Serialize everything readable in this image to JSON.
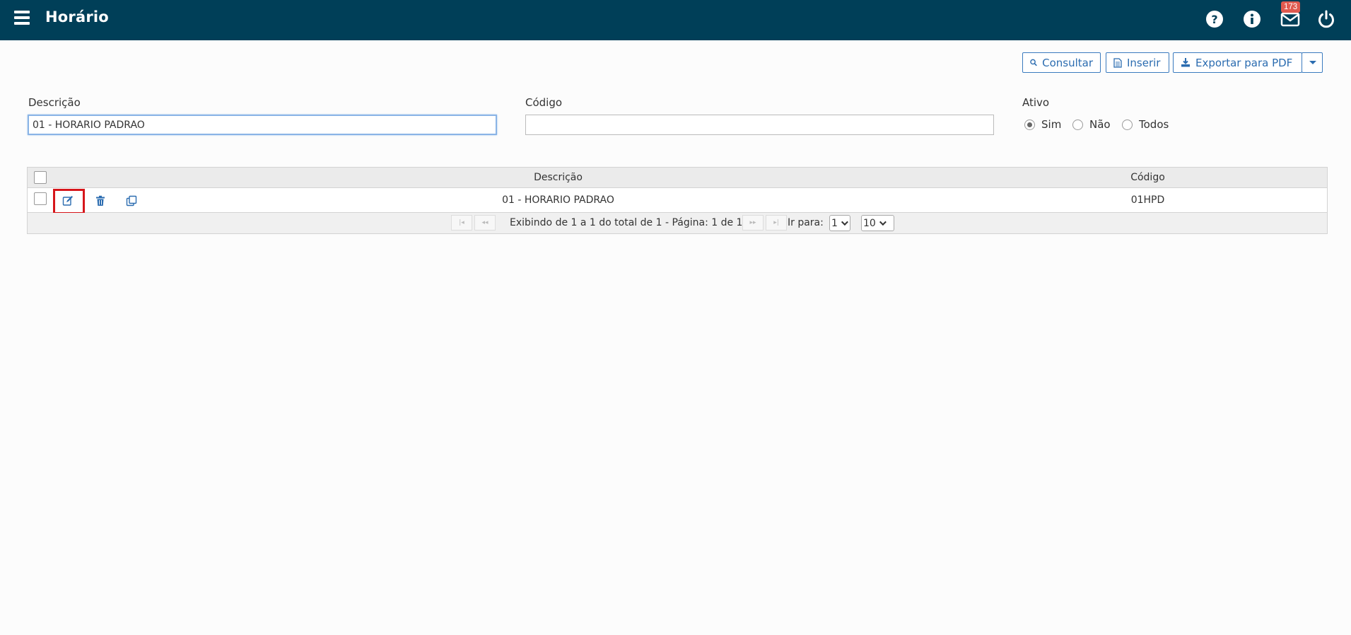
{
  "header": {
    "title": "Horário",
    "mail_badge": "173",
    "icons": [
      "hamburger-icon",
      "help-icon",
      "info-icon",
      "mail-icon",
      "power-icon"
    ]
  },
  "toolbar": {
    "consultar_label": "Consultar",
    "inserir_label": "Inserir",
    "exportar_label": "Exportar para PDF"
  },
  "form": {
    "descricao_label": "Descrição",
    "descricao_value": "01 - HORARIO PADRAO",
    "codigo_label": "Código",
    "codigo_value": "",
    "ativo_label": "Ativo",
    "ativo_options": [
      "Sim",
      "Não",
      "Todos"
    ],
    "ativo_selected": "Sim"
  },
  "grid": {
    "columns": [
      "Descrição",
      "Código"
    ],
    "rows": [
      {
        "descricao": "01 - HORARIO PADRAO",
        "codigo": "01HPD"
      }
    ],
    "pager": {
      "summary": "Exibindo de 1 a 1 do total de 1 - Página: 1 de 1",
      "goto_label": "Ir para:",
      "goto_value": "1",
      "page_size": "10"
    }
  },
  "colors": {
    "topbar": "#003f58",
    "accent": "#2b6cb0",
    "badge": "#e05a4f",
    "highlight": "#d6161b"
  }
}
